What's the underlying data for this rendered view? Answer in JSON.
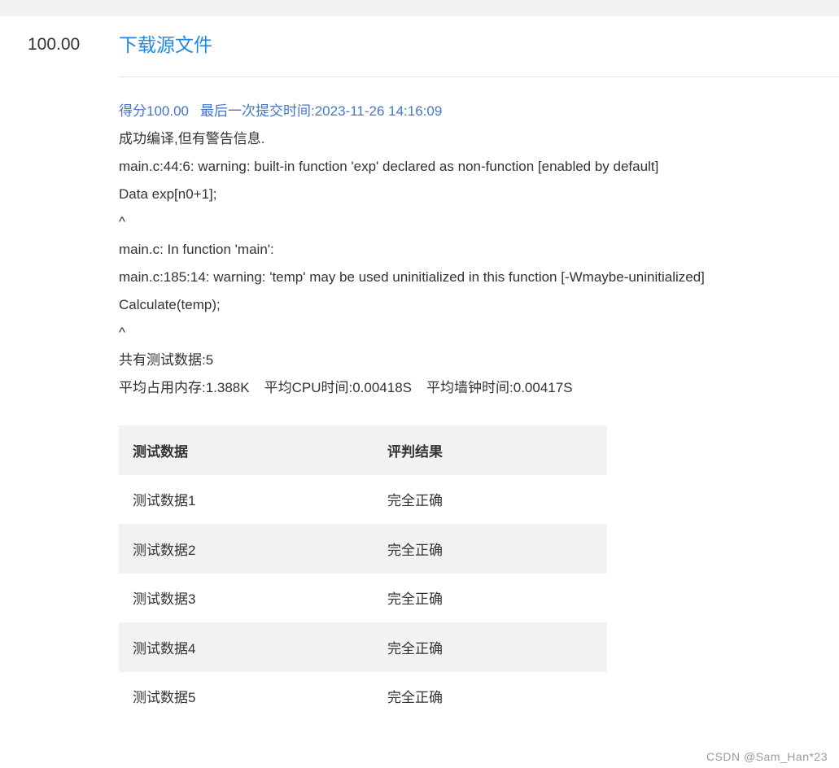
{
  "header": {
    "score": "100.00",
    "download_label": "下载源文件"
  },
  "submission": {
    "score_text": "得分100.00",
    "last_submit_text": "最后一次提交时间:2023-11-26 14:16:09"
  },
  "compile": {
    "status": "成功编译,但有警告信息.",
    "log_lines": [
      "main.c:44:6: warning: built-in function 'exp' declared as non-function [enabled by default]",
      "Data exp[n0+1];",
      "^",
      "main.c: In function 'main':",
      "main.c:185:14: warning: 'temp' may be used uninitialized in this function [-Wmaybe-uninitialized]",
      "Calculate(temp);",
      "^"
    ]
  },
  "stats": {
    "test_count": "共有测试数据:5",
    "avg_memory": "平均占用内存:1.388K",
    "avg_cpu": "平均CPU时间:0.00418S",
    "avg_wall": "平均墙钟时间:0.00417S"
  },
  "results_table": {
    "headers": [
      "测试数据",
      "评判结果"
    ],
    "rows": [
      [
        "测试数据1",
        "完全正确"
      ],
      [
        "测试数据2",
        "完全正确"
      ],
      [
        "测试数据3",
        "完全正确"
      ],
      [
        "测试数据4",
        "完全正确"
      ],
      [
        "测试数据5",
        "完全正确"
      ]
    ]
  },
  "watermark": "CSDN @Sam_Han*23",
  "colors": {
    "link": "#1e88e5",
    "meta": "#4774c8",
    "band": "#f2f2f2"
  }
}
